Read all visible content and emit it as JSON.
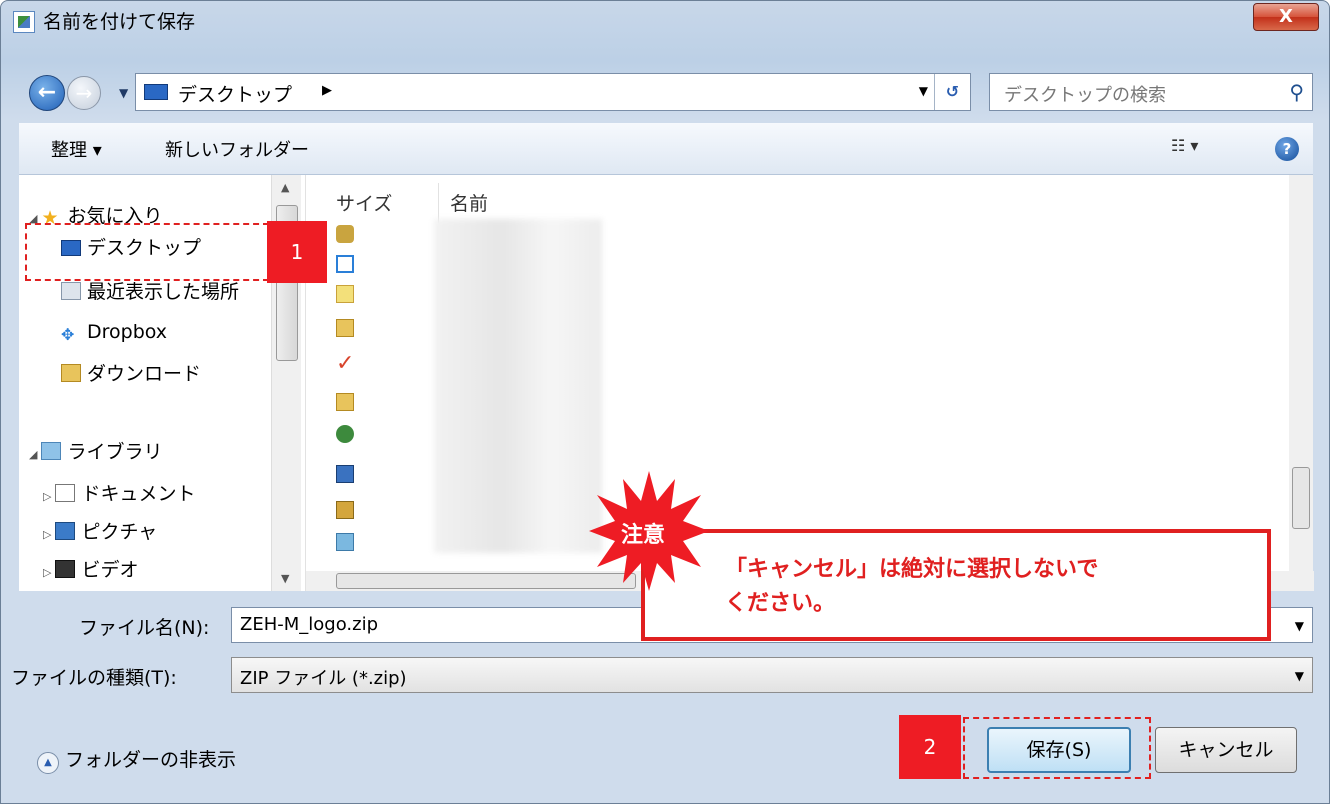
{
  "window": {
    "title": "名前を付けて保存",
    "close_label": "X"
  },
  "address": {
    "location": "デスクトップ",
    "search_placeholder": "デスクトップの検索"
  },
  "toolbar": {
    "organize_label": "整理 ▾",
    "new_folder_label": "新しいフォルダー",
    "view_label": "☷ ▾"
  },
  "nav": {
    "favorites": "お気に入り",
    "desktop": "デスクトップ",
    "recent_places": "最近表示した場所",
    "dropbox": "Dropbox",
    "downloads": "ダウンロード",
    "libraries": "ライブラリ",
    "documents": "ドキュメント",
    "pictures": "ピクチャ",
    "videos": "ビデオ"
  },
  "file_list": {
    "col_size": "サイズ",
    "col_name": "名前"
  },
  "form": {
    "filename_label": "ファイル名(N):",
    "filename_value": "ZEH-M_logo.zip",
    "filetype_label": "ファイルの種類(T):",
    "filetype_value": "ZIP ファイル (*.zip)",
    "hide_folders_label": "フォルダーの非表示",
    "save_label": "保存(S)",
    "cancel_label": "キャンセル"
  },
  "annotations": {
    "step1": "1",
    "step2": "2",
    "caution": "注意",
    "warning_line1": "「キャンセル」は絶対に選択しないで",
    "warning_line2": "ください。"
  }
}
